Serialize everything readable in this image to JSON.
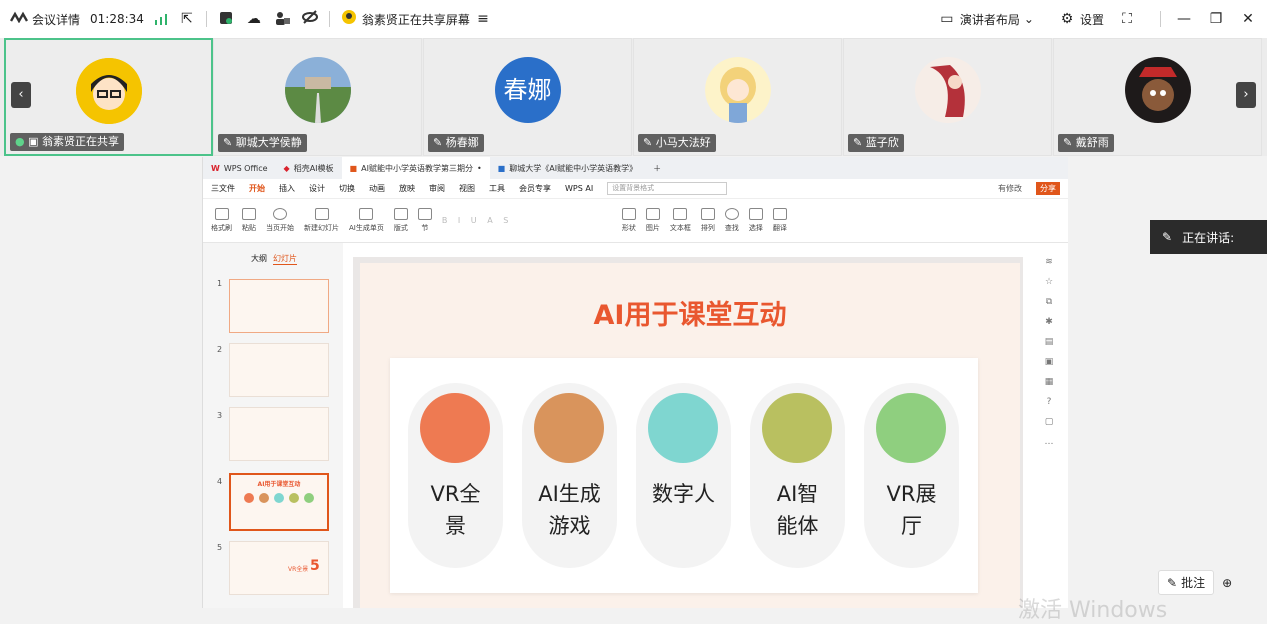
{
  "topbar": {
    "meeting_details": "会议详情",
    "timer": "01:28:34",
    "sharing_text": "翁素贤正在共享屏幕",
    "layout_label": "演讲者布局",
    "settings_label": "设置"
  },
  "participants": [
    {
      "name": "翁素贤正在共享",
      "avatar_text": ""
    },
    {
      "name": "聊城大学侯静",
      "avatar_text": ""
    },
    {
      "name": "杨春娜",
      "avatar_text": "春娜"
    },
    {
      "name": "小马大法好",
      "avatar_text": ""
    },
    {
      "name": "蓝子欣",
      "avatar_text": ""
    },
    {
      "name": "戴舒雨",
      "avatar_text": ""
    }
  ],
  "wps": {
    "tabs": [
      "WPS Office",
      "稻壳AI模板",
      "AI赋能中小学英语教学第三期分",
      "聊城大学《AI赋能中小学英语教学》"
    ],
    "menu": [
      "三文件",
      "开始",
      "插入",
      "设计",
      "切换",
      "动画",
      "放映",
      "审阅",
      "视图",
      "工具",
      "会员专享",
      "WPS AI"
    ],
    "search_placeholder": "设置背景格式",
    "modified": "有修改",
    "share": "分享",
    "ribbon": [
      "格式刷",
      "粘贴",
      "当页开始",
      "新建幻灯片",
      "AI生成单页",
      "版式",
      "节",
      "形状",
      "图片",
      "文本框",
      "排列",
      "查找",
      "选择",
      "翻译"
    ],
    "panel_tabs": [
      "大纲",
      "幻灯片"
    ],
    "thumb_numbers": [
      "1",
      "2",
      "3",
      "4",
      "5"
    ],
    "thumb4_title": "AI用于课堂互动",
    "thumb5_text": "VR全景",
    "thumb5_num": "5"
  },
  "slide": {
    "title": "AI用于课堂互动",
    "items": [
      {
        "label_line1": "VR全",
        "label_line2": "景",
        "color": "#ee7a52"
      },
      {
        "label_line1": "AI生成",
        "label_line2": "游戏",
        "color": "#d9945c"
      },
      {
        "label_line1": "数字人",
        "label_line2": "",
        "color": "#7fd6d0"
      },
      {
        "label_line1": "AI智",
        "label_line2": "能体",
        "color": "#b9c060"
      },
      {
        "label_line1": "VR展",
        "label_line2": "厅",
        "color": "#8fcf7f"
      }
    ]
  },
  "speaking": {
    "label": "正在讲话:"
  },
  "bottom": {
    "annotate": "批注"
  },
  "watermark": "激活 Windows"
}
